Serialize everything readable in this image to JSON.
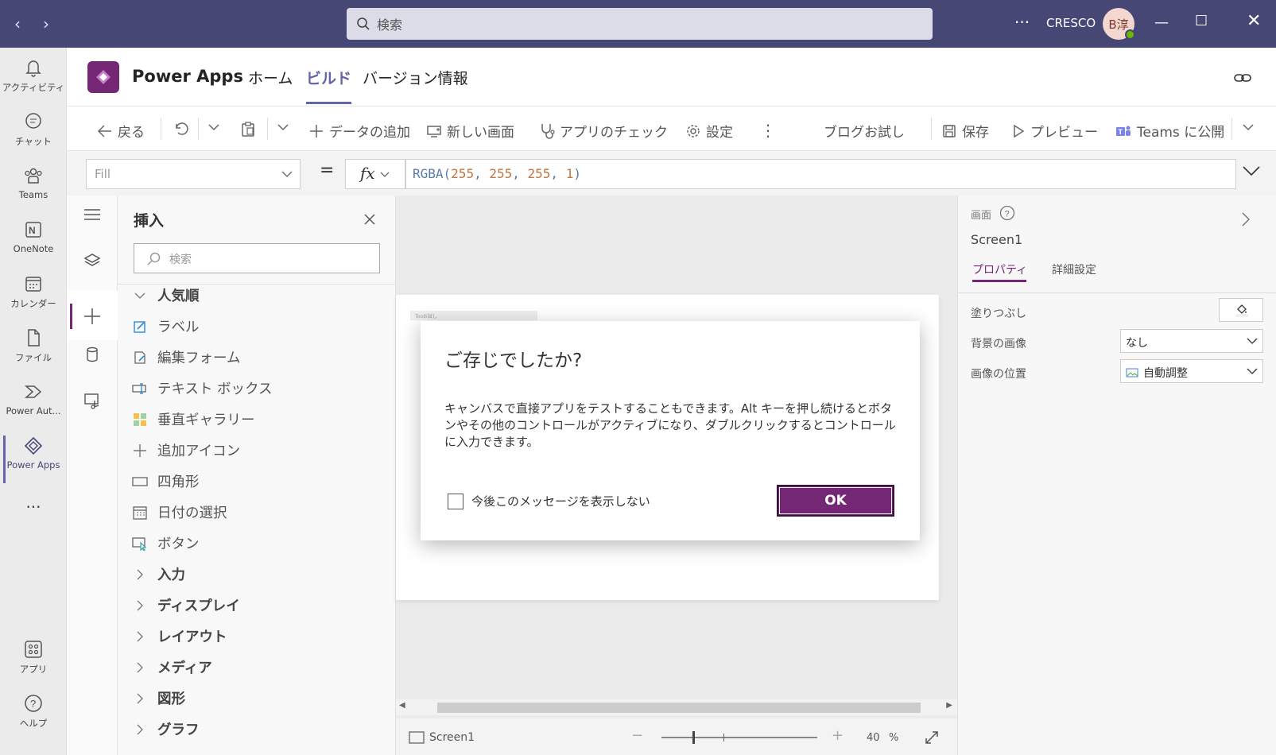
{
  "titlebar": {
    "search_placeholder": "検索",
    "more": "···",
    "org": "CRESCO",
    "avatar_initials": "B淳"
  },
  "rail": {
    "items": [
      {
        "label": "アクティビティ",
        "icon": "bell-icon"
      },
      {
        "label": "チャット",
        "icon": "chat-icon"
      },
      {
        "label": "Teams",
        "icon": "teams-icon"
      },
      {
        "label": "OneNote",
        "icon": "onenote-icon"
      },
      {
        "label": "カレンダー",
        "icon": "calendar-icon"
      },
      {
        "label": "ファイル",
        "icon": "file-icon"
      },
      {
        "label": "Power Aut...",
        "icon": "power-automate-icon"
      },
      {
        "label": "Power Apps",
        "icon": "power-apps-icon"
      },
      {
        "label": "···",
        "icon": "more-icon"
      },
      {
        "label": "アプリ",
        "icon": "apps-icon"
      },
      {
        "label": "ヘルプ",
        "icon": "help-icon"
      }
    ]
  },
  "app": {
    "name": "Power Apps",
    "tabs": [
      "ホーム",
      "ビルド",
      "バージョン情報"
    ],
    "active_tab": "ビルド"
  },
  "commands": {
    "back": "戻る",
    "add_data": "データの追加",
    "new_screen": "新しい画面",
    "app_check": "アプリのチェック",
    "settings": "設定",
    "app_title": "ブログお試し",
    "save": "保存",
    "preview": "プレビュー",
    "publish": "Teams に公開"
  },
  "formula": {
    "property": "Fill",
    "fx": "fx",
    "func": "RGBA(",
    "args": [
      "255",
      "255",
      "255",
      "1"
    ],
    "sep": ", ",
    "close": ")"
  },
  "insert": {
    "title": "挿入",
    "search_placeholder": "検索",
    "items": [
      {
        "label": "人気順",
        "type": "group-open"
      },
      {
        "label": "ラベル",
        "icon": "label-edit-icon"
      },
      {
        "label": "編集フォーム",
        "icon": "form-icon"
      },
      {
        "label": "テキスト ボックス",
        "icon": "textbox-icon"
      },
      {
        "label": "垂直ギャラリー",
        "icon": "gallery-icon"
      },
      {
        "label": "追加アイコン",
        "icon": "plus-icon"
      },
      {
        "label": "四角形",
        "icon": "rectangle-icon"
      },
      {
        "label": "日付の選択",
        "icon": "date-picker-icon"
      },
      {
        "label": "ボタン",
        "icon": "button-icon"
      },
      {
        "label": "入力",
        "type": "group"
      },
      {
        "label": "ディスプレイ",
        "type": "group"
      },
      {
        "label": "レイアウト",
        "type": "group"
      },
      {
        "label": "メディア",
        "type": "group"
      },
      {
        "label": "図形",
        "type": "group"
      },
      {
        "label": "グラフ",
        "type": "group"
      }
    ]
  },
  "canvas": {
    "tiny_label": "Tooお試し",
    "screen_name": "Screen1",
    "zoom": "40",
    "zoom_unit": "%"
  },
  "dialog": {
    "title": "ご存じでしたか?",
    "body": "キャンバスで直接アプリをテストすることもできます。Alt キーを押し続けるとボタンやその他のコントロールがアクティブになり、ダブルクリックするとコントロールに入力できます。",
    "checkbox": "今後このメッセージを表示しない",
    "ok": "OK"
  },
  "right_panel": {
    "section": "画面",
    "name": "Screen1",
    "tabs": [
      "プロパティ",
      "詳細設定"
    ],
    "fill_label": "塗りつぶし",
    "bg_label": "背景の画像",
    "bg_value": "なし",
    "pos_label": "画像の位置",
    "pos_value": "自動調整"
  },
  "colors": {
    "teams_bar": "#464775",
    "power_apps": "#742774",
    "accent": "#6264a7"
  }
}
